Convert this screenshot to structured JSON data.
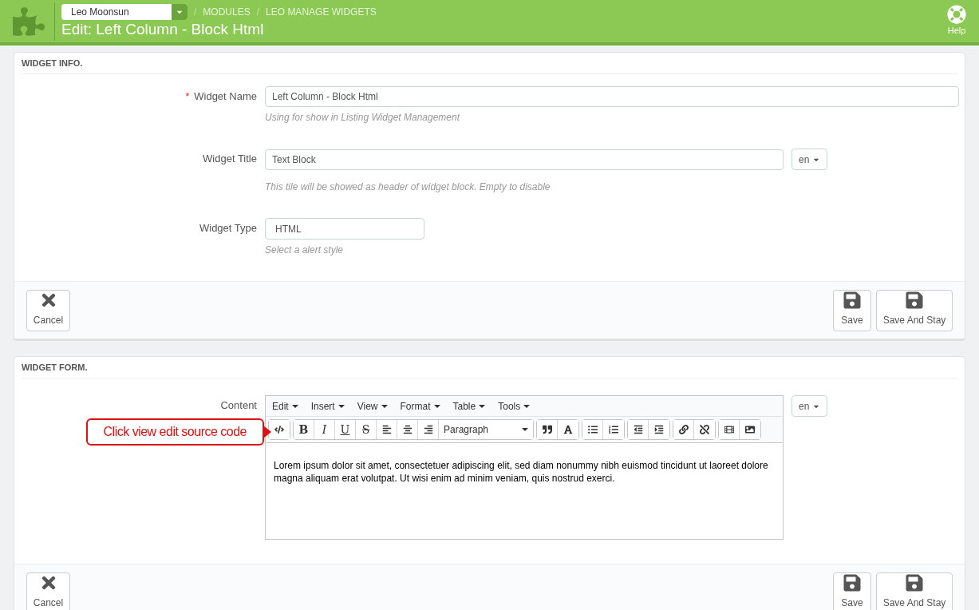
{
  "header": {
    "shop_select": "Leo Moonsun",
    "breadcrumb_separator": "/",
    "breadcrumbs": [
      "MODULES",
      "LEO MANAGE WIDGETS"
    ],
    "title": "Edit: Left Column - Block Html",
    "help": "Help"
  },
  "panels": [
    {
      "heading": "WIDGET INFO.",
      "fields": [
        {
          "kind": "text",
          "label": "Widget Name",
          "required_mark": "*",
          "value": "Left Column - Block Html",
          "hint": "Using for show in Listing Widget Management"
        },
        {
          "kind": "text",
          "label": "Widget Title",
          "value": "Text Block",
          "lang": "en",
          "hint": "This tile will be showed as header of widget block. Empty to disable"
        },
        {
          "kind": "select",
          "label": "Widget Type",
          "value": "HTML",
          "hint": "Select a alert style"
        }
      ],
      "footer": {
        "cancel": "Cancel",
        "save": "Save",
        "save_stay": "Save And Stay"
      }
    },
    {
      "heading": "WIDGET FORM.",
      "fields": [
        {
          "kind": "editor",
          "label": "Content",
          "menu": [
            "Edit",
            "Insert",
            "View",
            "Format",
            "Table",
            "Tools"
          ],
          "style_buttons": [
            "B",
            "I",
            "U",
            "S"
          ],
          "block_format": "Paragraph",
          "body": "Lorem ipsum dolor sit amet, consectetuer adipiscing elit, sed diam nonummy nibh euismod tincidunt ut laoreet dolore magna aliquam erat volutpat. Ut wisi enim ad minim veniam, quis nostrud exerci.",
          "lang": "en",
          "callout": "Click view edit source code"
        }
      ],
      "footer": {
        "cancel": "Cancel",
        "save": "Save",
        "save_stay": "Save And Stay"
      }
    }
  ]
}
